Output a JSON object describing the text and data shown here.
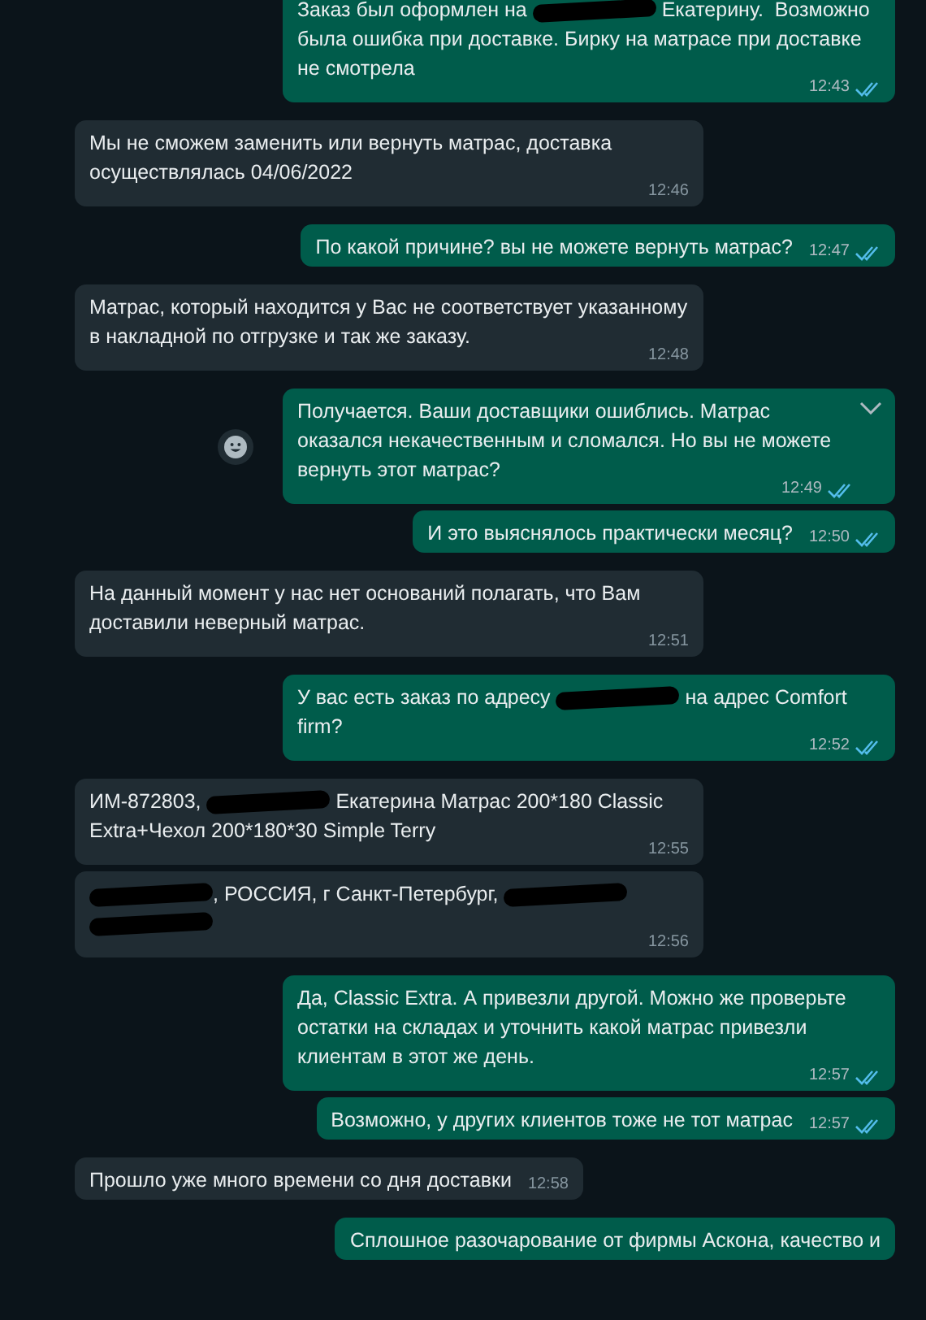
{
  "messages": [
    {
      "kind": "outgoing",
      "parts": [
        {
          "kind": "text",
          "text": "Заказ был оформлен на "
        },
        {
          "kind": "redacted"
        },
        {
          "kind": "text",
          "text": " Екатерину.  Возможно была ошибка при доставке. Бирку на матрасе при доставке не смотрела"
        }
      ],
      "time": "12:43",
      "read": true,
      "hovered": false
    },
    {
      "kind": "incoming",
      "parts": [
        {
          "kind": "text",
          "text": "Мы не сможем заменить или вернуть матрас, доставка осуществлялась 04/06/2022"
        }
      ],
      "time": "12:46",
      "hovered": false
    },
    {
      "kind": "outgoing",
      "parts": [
        {
          "kind": "text",
          "text": "По какой причине? вы не можете вернуть матрас?"
        }
      ],
      "time": "12:47",
      "read": true,
      "hovered": false
    },
    {
      "kind": "incoming",
      "parts": [
        {
          "kind": "text",
          "text": "Матрас, который находится у Вас не соответствует указанному в накладной по отгрузке и так же заказу."
        }
      ],
      "time": "12:48",
      "hovered": false
    },
    {
      "kind": "outgoing",
      "parts": [
        {
          "kind": "text",
          "text": "Получается. Ваши доставщики ошиблись. Матрас оказался некачественным и сломался. Но вы не можете вернуть этот матрас?"
        }
      ],
      "time": "12:49",
      "read": true,
      "hovered": true
    },
    {
      "kind": "outgoing",
      "parts": [
        {
          "kind": "text",
          "text": "И это выяснялось практически месяц?"
        }
      ],
      "time": "12:50",
      "read": true,
      "hovered": false
    },
    {
      "kind": "incoming",
      "parts": [
        {
          "kind": "text",
          "text": "На данный момент у нас нет оснований полагать, что Вам доставили неверный матрас."
        }
      ],
      "time": "12:51",
      "hovered": false
    },
    {
      "kind": "outgoing",
      "parts": [
        {
          "kind": "text",
          "text": "У вас есть заказ по адресу "
        },
        {
          "kind": "redacted"
        },
        {
          "kind": "text",
          "text": " на адрес Comfort firm?"
        }
      ],
      "time": "12:52",
      "read": true,
      "hovered": false
    },
    {
      "kind": "incoming",
      "parts": [
        {
          "kind": "text",
          "text": "ИМ-872803, "
        },
        {
          "kind": "redacted"
        },
        {
          "kind": "text",
          "text": " Екатерина Матрас 200*180 Classic Extra+Чехол 200*180*30 Simple Terry"
        }
      ],
      "time": "12:55",
      "hovered": false
    },
    {
      "kind": "incoming",
      "parts": [
        {
          "kind": "redacted"
        },
        {
          "kind": "text",
          "text": ", РОССИЯ, г Санкт-Петербург, "
        },
        {
          "kind": "redacted"
        },
        {
          "kind": "redacted"
        }
      ],
      "time": "12:56",
      "hovered": false
    },
    {
      "kind": "outgoing",
      "parts": [
        {
          "kind": "text",
          "text": "Да, Classic Extra. А привезли другой. Можно же проверьте остатки на складах и уточнить какой матрас привезли клиентам в этот же день."
        }
      ],
      "time": "12:57",
      "read": true,
      "hovered": false
    },
    {
      "kind": "outgoing",
      "parts": [
        {
          "kind": "text",
          "text": "Возможно, у других клиентов тоже не тот матрас"
        }
      ],
      "time": "12:57",
      "read": true,
      "hovered": false
    },
    {
      "kind": "incoming",
      "parts": [
        {
          "kind": "text",
          "text": "Прошло уже много времени со дня доставки"
        }
      ],
      "time": "12:58",
      "hovered": false
    },
    {
      "kind": "outgoing",
      "parts": [
        {
          "kind": "text",
          "text": "Сплошное разочарование от фирмы Аскона, качество и"
        }
      ],
      "hovered": false
    }
  ]
}
